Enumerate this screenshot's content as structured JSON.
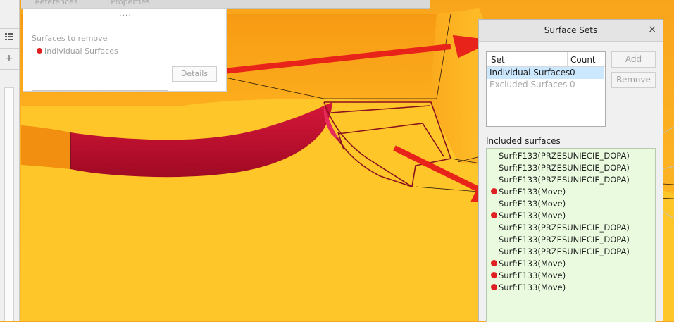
{
  "top_tabs": [
    "References",
    "Properties"
  ],
  "remove_panel": {
    "grip": "....",
    "label": "Surfaces to remove",
    "items": [
      "Individual Surfaces"
    ],
    "details_button": "Details"
  },
  "dialog": {
    "title": "Surface Sets",
    "close": "×",
    "sets_columns": [
      "Set",
      "Count"
    ],
    "sets": [
      {
        "name": "Individual Surfaces",
        "count": "0",
        "selected": true,
        "enabled": true
      },
      {
        "name": "Excluded Surfaces",
        "count": "0",
        "selected": false,
        "enabled": false
      }
    ],
    "add_button": "Add",
    "remove_button": "Remove",
    "included_label": "Included surfaces",
    "included": [
      {
        "text": "Surf:F133(PRZESUNIECIE_DOPA)",
        "marked": false
      },
      {
        "text": "Surf:F133(PRZESUNIECIE_DOPA)",
        "marked": false
      },
      {
        "text": "Surf:F133(PRZESUNIECIE_DOPA)",
        "marked": false
      },
      {
        "text": "Surf:F133(Move)",
        "marked": true
      },
      {
        "text": "Surf:F133(Move)",
        "marked": false
      },
      {
        "text": "Surf:F133(Move)",
        "marked": true
      },
      {
        "text": "Surf:F133(PRZESUNIECIE_DOPA)",
        "marked": false
      },
      {
        "text": "Surf:F133(PRZESUNIECIE_DOPA)",
        "marked": false
      },
      {
        "text": "Surf:F133(PRZESUNIECIE_DOPA)",
        "marked": false
      },
      {
        "text": "Surf:F133(Move)",
        "marked": true
      },
      {
        "text": "Surf:F133(Move)",
        "marked": true
      },
      {
        "text": "Surf:F133(Move)",
        "marked": true
      }
    ]
  },
  "left_toolbar": {
    "icons": [
      "list-icon",
      "plus-icon"
    ]
  },
  "colors": {
    "model_surface": "#ffc629",
    "highlight_surface": "#c8102e",
    "annotation_arrow": "#e8231a",
    "list_background": "#e9fadf",
    "selection": "#cce8ff",
    "marker": "#e02020"
  }
}
